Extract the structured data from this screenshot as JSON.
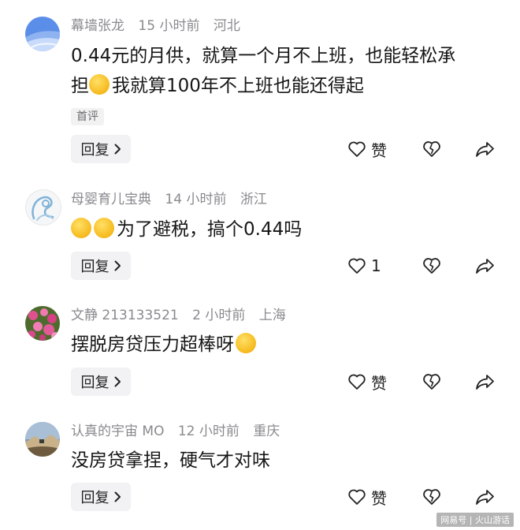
{
  "comments": [
    {
      "username": "幕墙张龙",
      "time": "15 小时前",
      "location": "河北",
      "text_line1": "0.44元的月供，就算一个月不上班，也能轻松承",
      "text_line2_prefix": "担",
      "text_line2_suffix": "我就算100年不上班也能还得起",
      "badge": "首评",
      "reply_label": "回复",
      "like_label": "赞",
      "avatar_icon": "blue-wave-avatar"
    },
    {
      "username": "母婴育儿宝典",
      "time": "14 小时前",
      "location": "浙江",
      "text": "为了避税，搞个0.44吗",
      "reply_label": "回复",
      "like_label": "1",
      "avatar_icon": "mother-baby-avatar"
    },
    {
      "username": "文静 213133521",
      "time": "2 小时前",
      "location": "上海",
      "text": "摆脱房贷压力超棒呀",
      "reply_label": "回复",
      "like_label": "赞",
      "avatar_icon": "pink-flowers-avatar"
    },
    {
      "username": "认真的宇宙 MO",
      "time": "12 小时前",
      "location": "重庆",
      "text": "没房贷拿捏，硬气才对味",
      "reply_label": "回复",
      "like_label": "赞",
      "avatar_icon": "landscape-avatar"
    }
  ],
  "watermark": "网易号 | 火山游话",
  "colors": {
    "meta": "#8a8a8f",
    "text": "#161616",
    "button_bg": "#f2f2f4"
  }
}
